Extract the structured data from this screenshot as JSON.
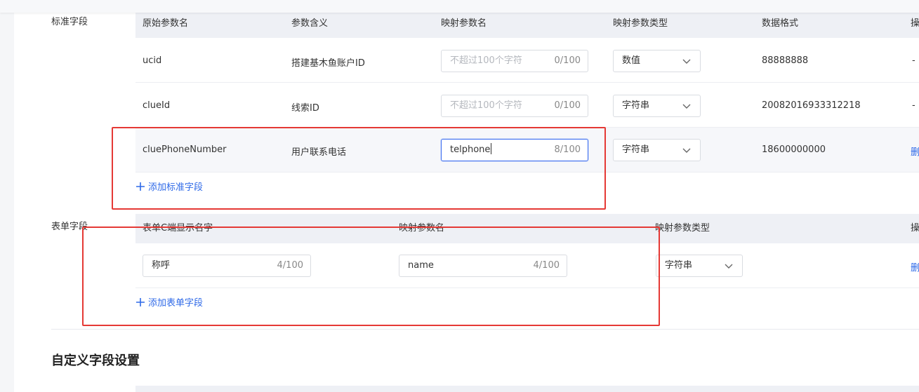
{
  "standard": {
    "label": "标准字段",
    "headers": [
      "原始参数名",
      "参数含义",
      "映射参数名",
      "映射参数类型",
      "数据格式",
      "操"
    ],
    "rows": [
      {
        "name": "ucid",
        "meaning": "搭建基木鱼账户ID",
        "input_value": "",
        "input_placeholder": "不超过100个字符",
        "count": "0/100",
        "type": "数值",
        "format": "88888888",
        "action": "-"
      },
      {
        "name": "clueId",
        "meaning": "线索ID",
        "input_value": "",
        "input_placeholder": "不超过100个字符",
        "count": "0/100",
        "type": "字符串",
        "format": "20082016933312218",
        "action": "-"
      },
      {
        "name": "cluePhoneNumber",
        "meaning": "用户联系电话",
        "input_value": "telphone",
        "input_placeholder": "",
        "count": "8/100",
        "type": "字符串",
        "format": "18600000000",
        "action": "删"
      }
    ],
    "add_label": "添加标准字段"
  },
  "form": {
    "label": "表单字段",
    "headers": [
      "表单C端显示名字",
      "映射参数名",
      "映射参数类型",
      "操"
    ],
    "row": {
      "display_name": "称呼",
      "display_count": "4/100",
      "mapped_name": "name",
      "mapped_count": "4/100",
      "type": "字符串",
      "action": "删"
    },
    "add_label": "添加表单字段"
  },
  "custom": {
    "heading": "自定义字段设置"
  },
  "colors": {
    "accent": "#2f6ae8",
    "highlight_box": "#e53935",
    "table_header": "#eef0f5"
  }
}
